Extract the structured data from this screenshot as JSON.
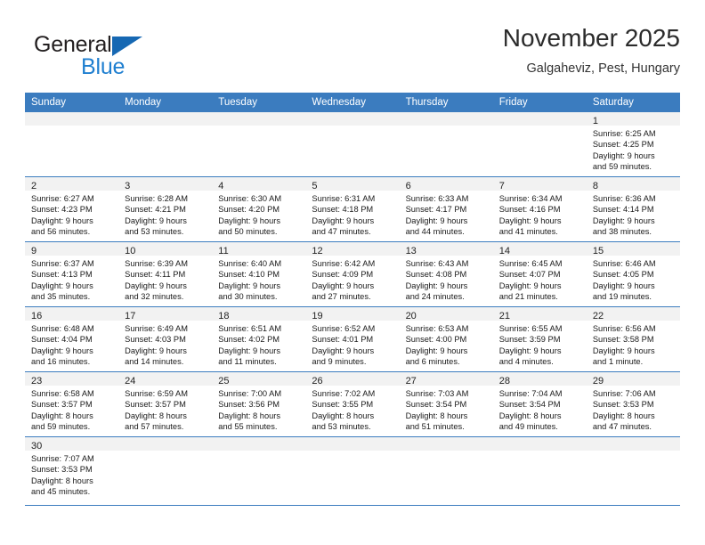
{
  "brand": {
    "name_top": "General",
    "name_bottom": "Blue",
    "accent_color": "#1668b3",
    "blue_text_color": "#1f7fd0"
  },
  "header": {
    "title": "November 2025",
    "subtitle": "Galgaheviz, Pest, Hungary"
  },
  "calendar": {
    "header_bg": "#3b7cbf",
    "daynum_bg": "#f2f2f2",
    "weekdays": [
      "Sunday",
      "Monday",
      "Tuesday",
      "Wednesday",
      "Thursday",
      "Friday",
      "Saturday"
    ],
    "weeks": [
      [
        {
          "day": "",
          "empty": true
        },
        {
          "day": "",
          "empty": true
        },
        {
          "day": "",
          "empty": true
        },
        {
          "day": "",
          "empty": true
        },
        {
          "day": "",
          "empty": true
        },
        {
          "day": "",
          "empty": true
        },
        {
          "day": "1",
          "sunrise": "Sunrise: 6:25 AM",
          "sunset": "Sunset: 4:25 PM",
          "daylight1": "Daylight: 9 hours",
          "daylight2": "and 59 minutes."
        }
      ],
      [
        {
          "day": "2",
          "sunrise": "Sunrise: 6:27 AM",
          "sunset": "Sunset: 4:23 PM",
          "daylight1": "Daylight: 9 hours",
          "daylight2": "and 56 minutes."
        },
        {
          "day": "3",
          "sunrise": "Sunrise: 6:28 AM",
          "sunset": "Sunset: 4:21 PM",
          "daylight1": "Daylight: 9 hours",
          "daylight2": "and 53 minutes."
        },
        {
          "day": "4",
          "sunrise": "Sunrise: 6:30 AM",
          "sunset": "Sunset: 4:20 PM",
          "daylight1": "Daylight: 9 hours",
          "daylight2": "and 50 minutes."
        },
        {
          "day": "5",
          "sunrise": "Sunrise: 6:31 AM",
          "sunset": "Sunset: 4:18 PM",
          "daylight1": "Daylight: 9 hours",
          "daylight2": "and 47 minutes."
        },
        {
          "day": "6",
          "sunrise": "Sunrise: 6:33 AM",
          "sunset": "Sunset: 4:17 PM",
          "daylight1": "Daylight: 9 hours",
          "daylight2": "and 44 minutes."
        },
        {
          "day": "7",
          "sunrise": "Sunrise: 6:34 AM",
          "sunset": "Sunset: 4:16 PM",
          "daylight1": "Daylight: 9 hours",
          "daylight2": "and 41 minutes."
        },
        {
          "day": "8",
          "sunrise": "Sunrise: 6:36 AM",
          "sunset": "Sunset: 4:14 PM",
          "daylight1": "Daylight: 9 hours",
          "daylight2": "and 38 minutes."
        }
      ],
      [
        {
          "day": "9",
          "sunrise": "Sunrise: 6:37 AM",
          "sunset": "Sunset: 4:13 PM",
          "daylight1": "Daylight: 9 hours",
          "daylight2": "and 35 minutes."
        },
        {
          "day": "10",
          "sunrise": "Sunrise: 6:39 AM",
          "sunset": "Sunset: 4:11 PM",
          "daylight1": "Daylight: 9 hours",
          "daylight2": "and 32 minutes."
        },
        {
          "day": "11",
          "sunrise": "Sunrise: 6:40 AM",
          "sunset": "Sunset: 4:10 PM",
          "daylight1": "Daylight: 9 hours",
          "daylight2": "and 30 minutes."
        },
        {
          "day": "12",
          "sunrise": "Sunrise: 6:42 AM",
          "sunset": "Sunset: 4:09 PM",
          "daylight1": "Daylight: 9 hours",
          "daylight2": "and 27 minutes."
        },
        {
          "day": "13",
          "sunrise": "Sunrise: 6:43 AM",
          "sunset": "Sunset: 4:08 PM",
          "daylight1": "Daylight: 9 hours",
          "daylight2": "and 24 minutes."
        },
        {
          "day": "14",
          "sunrise": "Sunrise: 6:45 AM",
          "sunset": "Sunset: 4:07 PM",
          "daylight1": "Daylight: 9 hours",
          "daylight2": "and 21 minutes."
        },
        {
          "day": "15",
          "sunrise": "Sunrise: 6:46 AM",
          "sunset": "Sunset: 4:05 PM",
          "daylight1": "Daylight: 9 hours",
          "daylight2": "and 19 minutes."
        }
      ],
      [
        {
          "day": "16",
          "sunrise": "Sunrise: 6:48 AM",
          "sunset": "Sunset: 4:04 PM",
          "daylight1": "Daylight: 9 hours",
          "daylight2": "and 16 minutes."
        },
        {
          "day": "17",
          "sunrise": "Sunrise: 6:49 AM",
          "sunset": "Sunset: 4:03 PM",
          "daylight1": "Daylight: 9 hours",
          "daylight2": "and 14 minutes."
        },
        {
          "day": "18",
          "sunrise": "Sunrise: 6:51 AM",
          "sunset": "Sunset: 4:02 PM",
          "daylight1": "Daylight: 9 hours",
          "daylight2": "and 11 minutes."
        },
        {
          "day": "19",
          "sunrise": "Sunrise: 6:52 AM",
          "sunset": "Sunset: 4:01 PM",
          "daylight1": "Daylight: 9 hours",
          "daylight2": "and 9 minutes."
        },
        {
          "day": "20",
          "sunrise": "Sunrise: 6:53 AM",
          "sunset": "Sunset: 4:00 PM",
          "daylight1": "Daylight: 9 hours",
          "daylight2": "and 6 minutes."
        },
        {
          "day": "21",
          "sunrise": "Sunrise: 6:55 AM",
          "sunset": "Sunset: 3:59 PM",
          "daylight1": "Daylight: 9 hours",
          "daylight2": "and 4 minutes."
        },
        {
          "day": "22",
          "sunrise": "Sunrise: 6:56 AM",
          "sunset": "Sunset: 3:58 PM",
          "daylight1": "Daylight: 9 hours",
          "daylight2": "and 1 minute."
        }
      ],
      [
        {
          "day": "23",
          "sunrise": "Sunrise: 6:58 AM",
          "sunset": "Sunset: 3:57 PM",
          "daylight1": "Daylight: 8 hours",
          "daylight2": "and 59 minutes."
        },
        {
          "day": "24",
          "sunrise": "Sunrise: 6:59 AM",
          "sunset": "Sunset: 3:57 PM",
          "daylight1": "Daylight: 8 hours",
          "daylight2": "and 57 minutes."
        },
        {
          "day": "25",
          "sunrise": "Sunrise: 7:00 AM",
          "sunset": "Sunset: 3:56 PM",
          "daylight1": "Daylight: 8 hours",
          "daylight2": "and 55 minutes."
        },
        {
          "day": "26",
          "sunrise": "Sunrise: 7:02 AM",
          "sunset": "Sunset: 3:55 PM",
          "daylight1": "Daylight: 8 hours",
          "daylight2": "and 53 minutes."
        },
        {
          "day": "27",
          "sunrise": "Sunrise: 7:03 AM",
          "sunset": "Sunset: 3:54 PM",
          "daylight1": "Daylight: 8 hours",
          "daylight2": "and 51 minutes."
        },
        {
          "day": "28",
          "sunrise": "Sunrise: 7:04 AM",
          "sunset": "Sunset: 3:54 PM",
          "daylight1": "Daylight: 8 hours",
          "daylight2": "and 49 minutes."
        },
        {
          "day": "29",
          "sunrise": "Sunrise: 7:06 AM",
          "sunset": "Sunset: 3:53 PM",
          "daylight1": "Daylight: 8 hours",
          "daylight2": "and 47 minutes."
        }
      ],
      [
        {
          "day": "30",
          "sunrise": "Sunrise: 7:07 AM",
          "sunset": "Sunset: 3:53 PM",
          "daylight1": "Daylight: 8 hours",
          "daylight2": "and 45 minutes."
        },
        {
          "day": "",
          "empty": true
        },
        {
          "day": "",
          "empty": true
        },
        {
          "day": "",
          "empty": true
        },
        {
          "day": "",
          "empty": true
        },
        {
          "day": "",
          "empty": true
        },
        {
          "day": "",
          "empty": true
        }
      ]
    ]
  }
}
